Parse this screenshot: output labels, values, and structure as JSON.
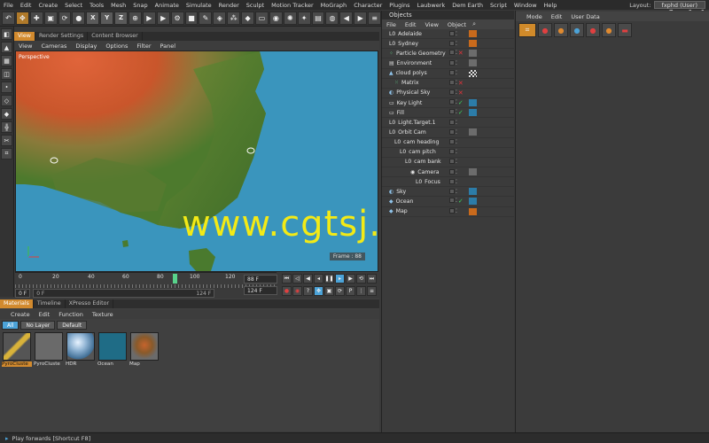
{
  "menubar": {
    "items": [
      "File",
      "Edit",
      "Create",
      "Select",
      "Tools",
      "Mesh",
      "Snap",
      "Animate",
      "Simulate",
      "Render",
      "Sculpt",
      "Motion Tracker",
      "MoGraph",
      "Character",
      "Plugins",
      "Laubwerk",
      "Dem Earth",
      "Script",
      "Window",
      "Help"
    ],
    "layout_label": "Layout:",
    "layout_value": "fxphd (User)",
    "brand": "fxphd"
  },
  "toolbar": {
    "axis_letters": [
      "X",
      "Y",
      "Z"
    ]
  },
  "viewport": {
    "tabs": [
      "View",
      "Render Settings",
      "Content Browser"
    ],
    "menu": [
      "View",
      "Cameras",
      "Display",
      "Options",
      "Filter",
      "Panel"
    ],
    "label": "Perspective",
    "frame_readout": "Frame : 88",
    "watermark": "www.cgtsj.com",
    "colors": {
      "ocean": "#3a95bd",
      "land_green": "#4a7b2e",
      "land_orange": "#d2562a"
    }
  },
  "timeline": {
    "ticks": [
      "0",
      "20",
      "40",
      "60",
      "80",
      "100",
      "120"
    ],
    "playhead_frame": 88,
    "max_frame": 124,
    "start_field": "0 F",
    "range_start": "0 F",
    "range_end": "124 F",
    "current_frame_field": "88 F",
    "end_field": "124 F"
  },
  "objects": {
    "title": "Objects",
    "menu": [
      "File",
      "Edit",
      "View",
      "Object"
    ],
    "rows": [
      {
        "name": "Adelaide",
        "indent": 0,
        "icon": "null-icon",
        "tag": "orange"
      },
      {
        "name": "Sydney",
        "indent": 0,
        "icon": "null-icon",
        "tag": "orange"
      },
      {
        "name": "Particle Geometry",
        "indent": 0,
        "icon": "particle-icon",
        "tag": "grey",
        "x": true
      },
      {
        "name": "Environment",
        "indent": 0,
        "icon": "environment-icon",
        "tag": "grey"
      },
      {
        "name": "cloud polys",
        "indent": 0,
        "icon": "polygon-icon",
        "tag": "checker"
      },
      {
        "name": "Matrix",
        "indent": 1,
        "icon": "matrix-icon",
        "x": true
      },
      {
        "name": "Physical Sky",
        "indent": 0,
        "icon": "sky-icon",
        "x": true
      },
      {
        "name": "Key Light",
        "indent": 0,
        "icon": "light-icon",
        "check": true,
        "tag": "target"
      },
      {
        "name": "Fill",
        "indent": 0,
        "icon": "light-icon",
        "check": true,
        "tag": "target"
      },
      {
        "name": "Light.Target.1",
        "indent": 0,
        "icon": "null-icon"
      },
      {
        "name": "Orbit Cam",
        "indent": 0,
        "icon": "null-icon",
        "tag": "dots"
      },
      {
        "name": "cam heading",
        "indent": 1,
        "icon": "null-icon"
      },
      {
        "name": "cam pitch",
        "indent": 2,
        "icon": "null-icon"
      },
      {
        "name": "cam bank",
        "indent": 3,
        "icon": "null-icon"
      },
      {
        "name": "Camera",
        "indent": 4,
        "icon": "camera-icon",
        "tag": "dots"
      },
      {
        "name": "Focus",
        "indent": 5,
        "icon": "null-icon"
      },
      {
        "name": "Sky",
        "indent": 0,
        "icon": "sky-icon",
        "tag": "sphere"
      },
      {
        "name": "Ocean",
        "indent": 0,
        "icon": "plane-icon",
        "check": true,
        "tag": "blue"
      },
      {
        "name": "Map",
        "indent": 0,
        "icon": "plane-icon",
        "tag": "map"
      }
    ]
  },
  "attributes": {
    "menu": [
      "Mode",
      "Edit",
      "User Data"
    ]
  },
  "materials": {
    "tabs": [
      "Materials",
      "Timeline",
      "XPresso Editor"
    ],
    "menu": [
      "Create",
      "Edit",
      "Function",
      "Texture"
    ],
    "filters": [
      "All",
      "No Layer",
      "Default"
    ],
    "items": [
      {
        "name": "PyroCluste",
        "swatch": "pyro"
      },
      {
        "name": "PyroCluste",
        "swatch": "pyro2"
      },
      {
        "name": "HDR",
        "swatch": "hdr"
      },
      {
        "name": "Ocean",
        "swatch": "ocean"
      },
      {
        "name": "Map",
        "swatch": "map"
      }
    ]
  },
  "status": {
    "text": "Play forwards [Shortcut F8]"
  }
}
